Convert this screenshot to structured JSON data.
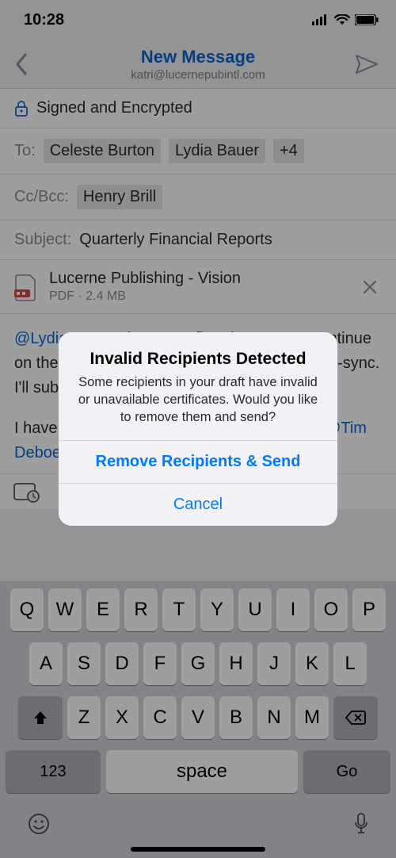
{
  "status": {
    "time": "10:28"
  },
  "nav": {
    "title": "New Message",
    "subtitle": "katri@lucernepubintl.com"
  },
  "security": {
    "label": "Signed and Encrypted"
  },
  "to": {
    "label": "To:",
    "recipients": [
      "Celeste Burton",
      "Lydia Bauer"
    ],
    "overflow": "+4"
  },
  "cc": {
    "label": "Cc/Bcc:",
    "recipients": [
      "Henry Brill"
    ]
  },
  "subject": {
    "label": "Subject:",
    "value": "Quarterly Financial Reports"
  },
  "attachment": {
    "name": "Lucerne Publishing - Vision",
    "meta": "PDF · 2.4 MB"
  },
  "body": {
    "line1_mention": "@Lydia Bauer",
    "line1_rest": " please confirm that we can continue on the action plan we drafted in the next cross-sync. I'll submit the memo once confirmed.",
    "line2_pre": "I have also linked the Vision document from ",
    "line2_mention": "@Tim Deboer",
    "line2_rest": " for reference."
  },
  "alert": {
    "title": "Invalid Recipients Detected",
    "message": "Some recipients in your draft have invalid or unavailable certificates. Would you like to remove them and send?",
    "primary": "Remove Recipients & Send",
    "cancel": "Cancel"
  },
  "keyboard": {
    "row1": [
      "Q",
      "W",
      "E",
      "R",
      "T",
      "Y",
      "U",
      "I",
      "O",
      "P"
    ],
    "row2": [
      "A",
      "S",
      "D",
      "F",
      "G",
      "H",
      "J",
      "K",
      "L"
    ],
    "row3": [
      "Z",
      "X",
      "C",
      "V",
      "B",
      "N",
      "M"
    ],
    "numKey": "123",
    "spaceKey": "space",
    "goKey": "Go"
  }
}
